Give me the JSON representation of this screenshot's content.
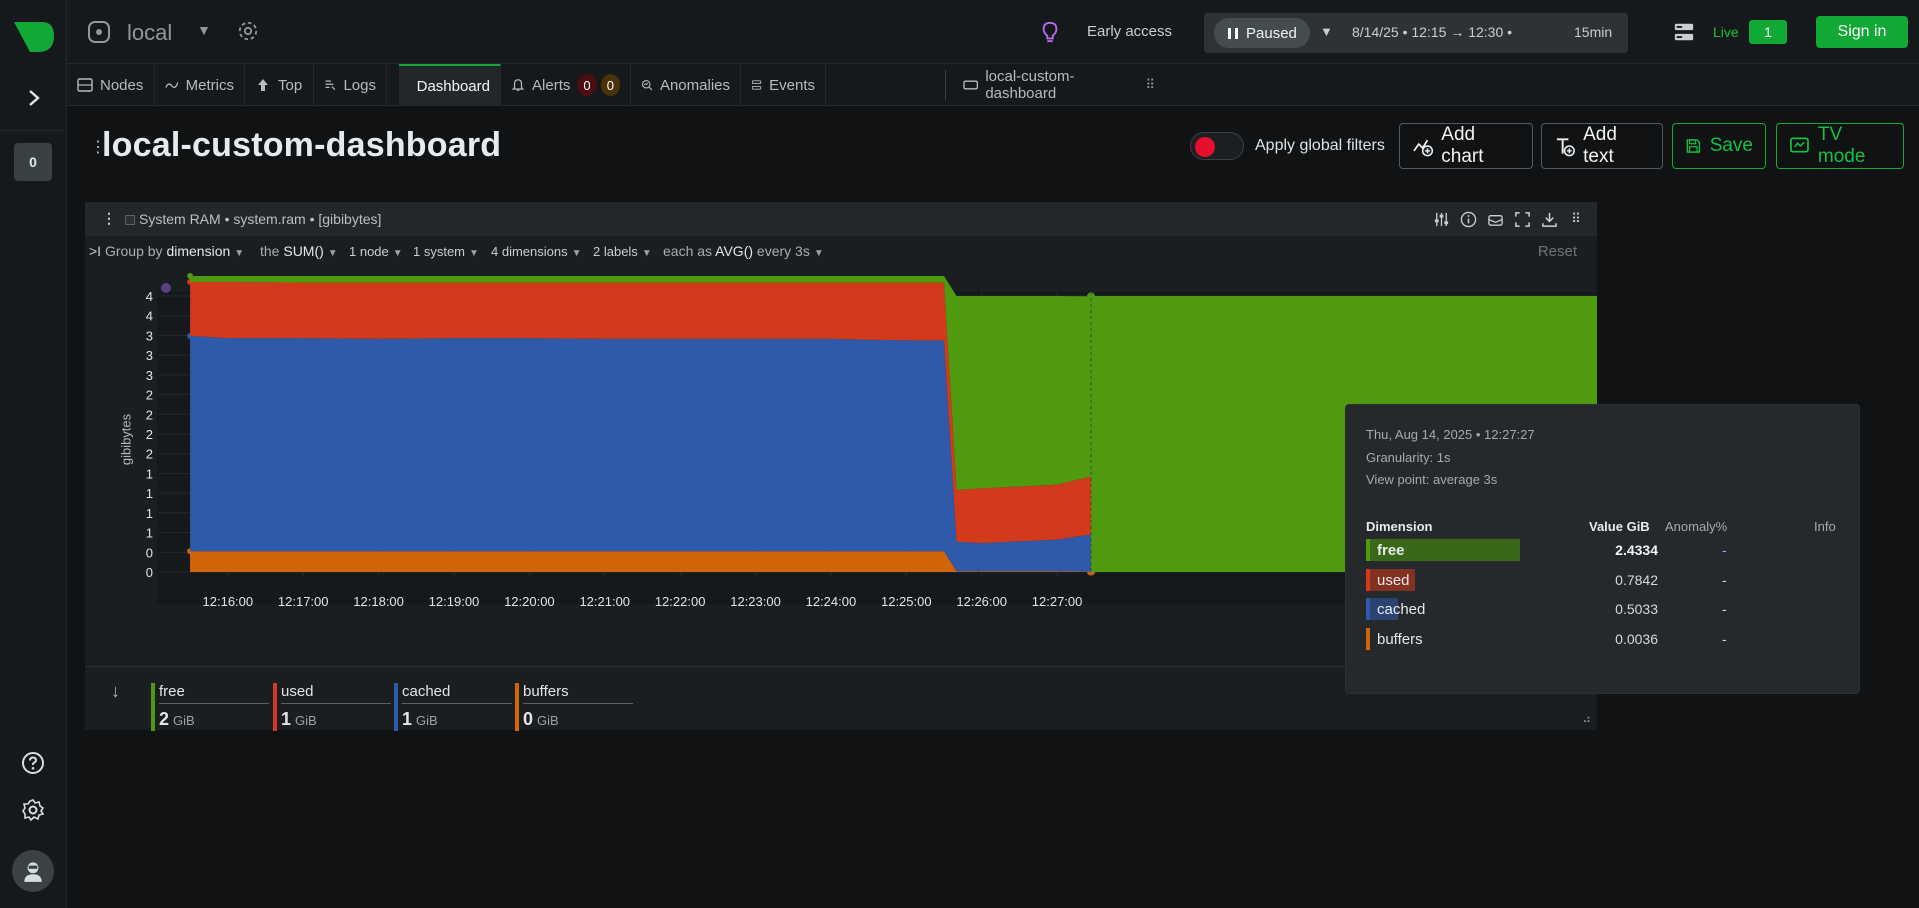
{
  "topbar": {
    "space_name": "local",
    "early_access": "Early access",
    "paused_label": "Paused",
    "time_range": "8/14/25 • 12:15 → 12:30 •",
    "duration": "15min",
    "live_label": "Live",
    "live_count": "1",
    "sign_in": "Sign in"
  },
  "rail": {
    "badge": "0"
  },
  "tabs": [
    {
      "label": "Nodes"
    },
    {
      "label": "Metrics"
    },
    {
      "label": "Top"
    },
    {
      "label": "Logs"
    },
    {
      "label": "Dashboard"
    },
    {
      "label": "Alerts"
    },
    {
      "label": "Anomalies"
    },
    {
      "label": "Events"
    },
    {
      "label": "local-custom-dashboard"
    }
  ],
  "alerts": {
    "critical": "0",
    "warning": "0"
  },
  "dashboard": {
    "title": "local-custom-dashboard",
    "toggle_label": "Apply global filters",
    "add_chart": "Add chart",
    "add_text": "Add text",
    "save": "Save",
    "tv_mode": "TV mode"
  },
  "card": {
    "title": "System RAM • system.ram • [gibibytes]",
    "group_by_prefix": "Group by",
    "group_by_value": "dimension",
    "agg_prefix": "the",
    "agg_value": "SUM()",
    "nodes": "1 node",
    "systems": "1 system",
    "dimensions": "4 dimensions",
    "labels": "2 labels",
    "each_as_prefix": "each as",
    "each_as_value": "AVG()",
    "every": "every 3s",
    "reset": "Reset",
    "ylabel": "gibibytes"
  },
  "legend": [
    {
      "name": "free",
      "value": "2",
      "unit": "GiB",
      "color": "#4f9a0f"
    },
    {
      "name": "used",
      "value": "1",
      "unit": "GiB",
      "color": "#d23a1b"
    },
    {
      "name": "cached",
      "value": "1",
      "unit": "GiB",
      "color": "#2f5aaa"
    },
    {
      "name": "buffers",
      "value": "0",
      "unit": "GiB",
      "color": "#d0650a"
    }
  ],
  "tooltip": {
    "datetime": "Thu, Aug 14, 2025 • 12:27:27",
    "granularity": "Granularity: 1s",
    "view_point": "View point: average 3s",
    "col_dimension": "Dimension",
    "col_value": "Value GiB",
    "col_anomaly": "Anomaly%",
    "col_info": "Info",
    "rows": [
      {
        "name": "free",
        "value": "2.4334",
        "anomaly": "-",
        "color": "#4f9a0f",
        "fill": 1.0
      },
      {
        "name": "used",
        "value": "0.7842",
        "anomaly": "-",
        "color": "#d23a1b",
        "fill": 0.32
      },
      {
        "name": "cached",
        "value": "0.5033",
        "anomaly": "-",
        "color": "#2f5aaa",
        "fill": 0.21
      },
      {
        "name": "buffers",
        "value": "0.0036",
        "anomaly": "-",
        "color": "#d0650a",
        "fill": 0.0
      }
    ]
  },
  "chart_data": {
    "type": "area",
    "stacked": true,
    "x": [
      "12:15:30",
      "12:16:00",
      "12:17:00",
      "12:18:00",
      "12:19:00",
      "12:20:00",
      "12:21:00",
      "12:22:00",
      "12:23:00",
      "12:24:00",
      "12:25:00",
      "12:25:30",
      "12:25:40",
      "12:26:00",
      "12:27:00",
      "12:27:27"
    ],
    "x_tick_labels": [
      "12:16:00",
      "12:17:00",
      "12:18:00",
      "12:19:00",
      "12:20:00",
      "12:21:00",
      "12:22:00",
      "12:23:00",
      "12:24:00",
      "12:25:00",
      "12:26:00",
      "12:27:00"
    ],
    "y_tick_labels": [
      "0",
      "0",
      "1",
      "1",
      "1",
      "1",
      "2",
      "2",
      "2",
      "2",
      "3",
      "3",
      "3",
      "4",
      "4"
    ],
    "ylabel": "gibibytes",
    "ylim": [
      0,
      3.73
    ],
    "series": [
      {
        "name": "buffers",
        "color": "#d0650a",
        "values": [
          0.28,
          0.28,
          0.28,
          0.28,
          0.28,
          0.28,
          0.28,
          0.28,
          0.28,
          0.28,
          0.28,
          0.28,
          0.01,
          0.01,
          0.01,
          0.0036
        ]
      },
      {
        "name": "cached",
        "color": "#2f5aaa",
        "values": [
          2.91,
          2.88,
          2.88,
          2.87,
          2.88,
          2.88,
          2.87,
          2.87,
          2.87,
          2.87,
          2.85,
          2.85,
          0.4,
          0.38,
          0.43,
          0.5033
        ]
      },
      {
        "name": "used",
        "color": "#d23a1b",
        "values": [
          0.73,
          0.76,
          0.75,
          0.76,
          0.75,
          0.75,
          0.76,
          0.76,
          0.76,
          0.76,
          0.78,
          0.78,
          0.7,
          0.74,
          0.74,
          0.7842
        ]
      },
      {
        "name": "free",
        "color": "#4f9a0f",
        "values": [
          0.08,
          0.08,
          0.09,
          0.09,
          0.09,
          0.09,
          0.09,
          0.09,
          0.09,
          0.09,
          0.09,
          0.09,
          2.62,
          2.6,
          2.55,
          2.4334
        ]
      }
    ]
  }
}
